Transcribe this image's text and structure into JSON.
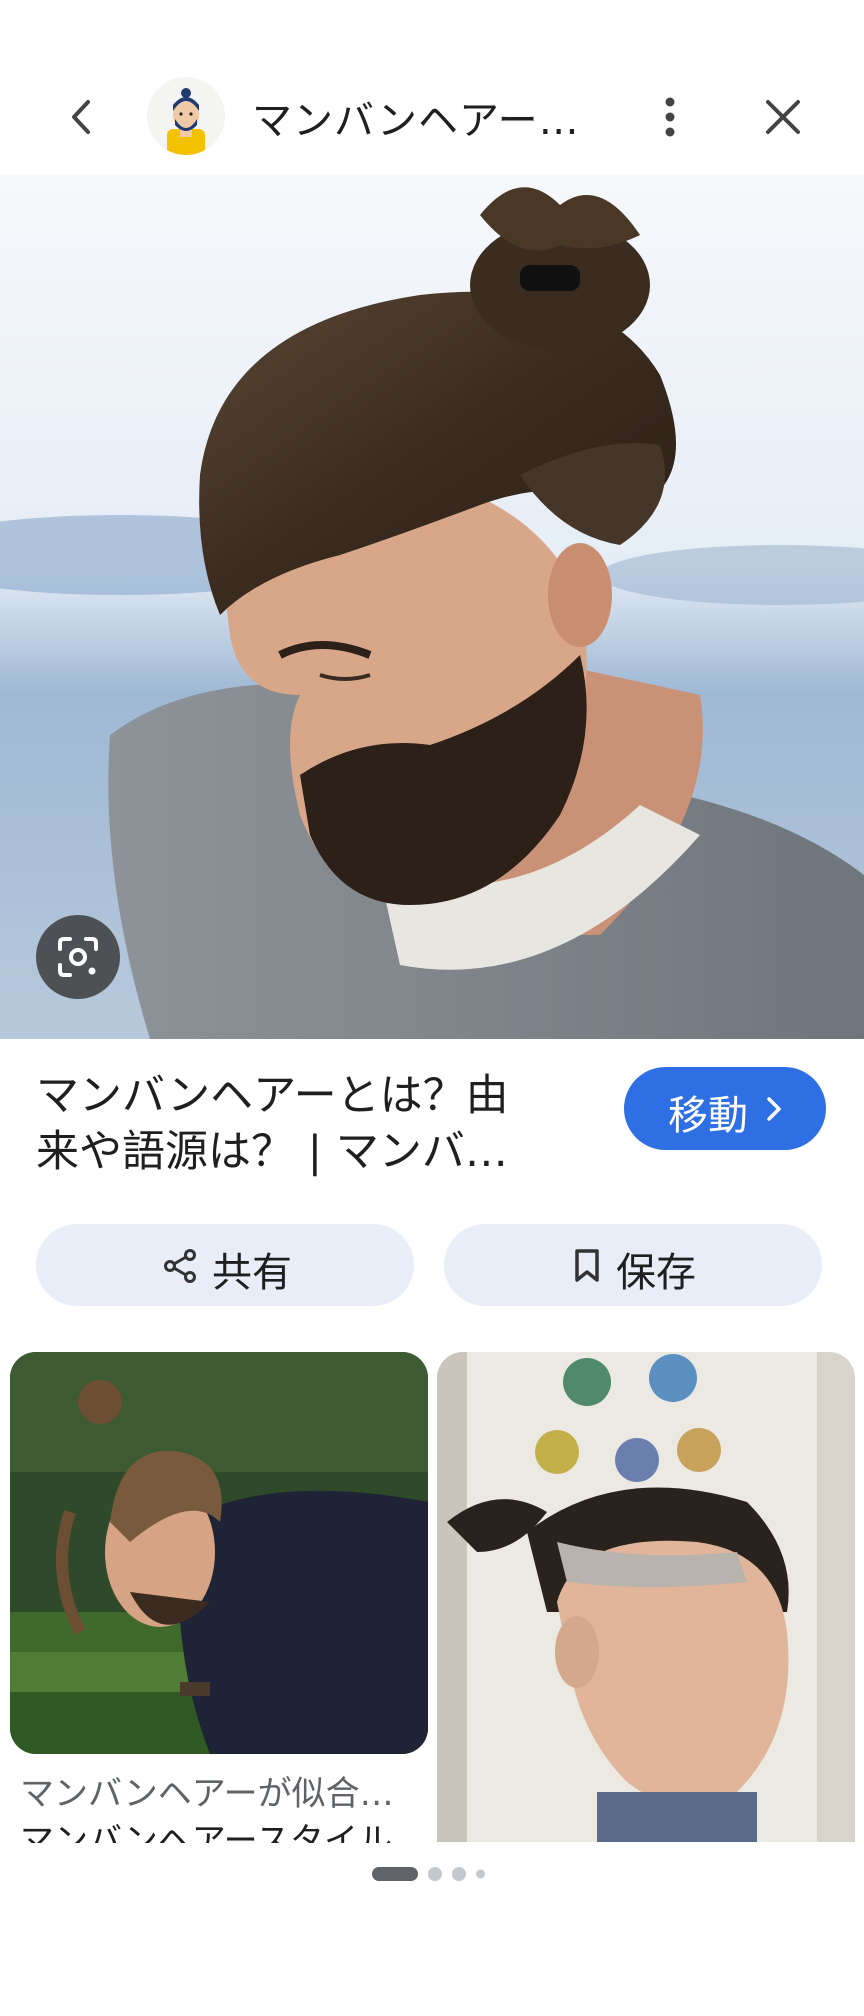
{
  "header": {
    "title": "マンバンヘアー…",
    "back_icon": "chevron-left-icon",
    "more_icon": "more-vert-icon",
    "close_icon": "close-icon"
  },
  "hero": {
    "lens_icon": "lens-search-icon"
  },
  "result": {
    "title_line1": "マンバンヘアーとは？由",
    "title_line2": "来や語源は？ | マンバ…",
    "goto_label": "移動"
  },
  "actions": {
    "share_label": "共有",
    "save_label": "保存"
  },
  "related": [
    {
      "caption_source": "マンバンヘアーが似合…",
      "caption_title": "マンバンヘアースタイル"
    },
    {
      "caption_source": "",
      "caption_title": ""
    }
  ],
  "pager": {
    "current": 1,
    "total": 4
  },
  "colors": {
    "accent": "#2f6fe4",
    "pill_bg": "#e8edf7",
    "lens_bg": "#3c3c3c"
  }
}
